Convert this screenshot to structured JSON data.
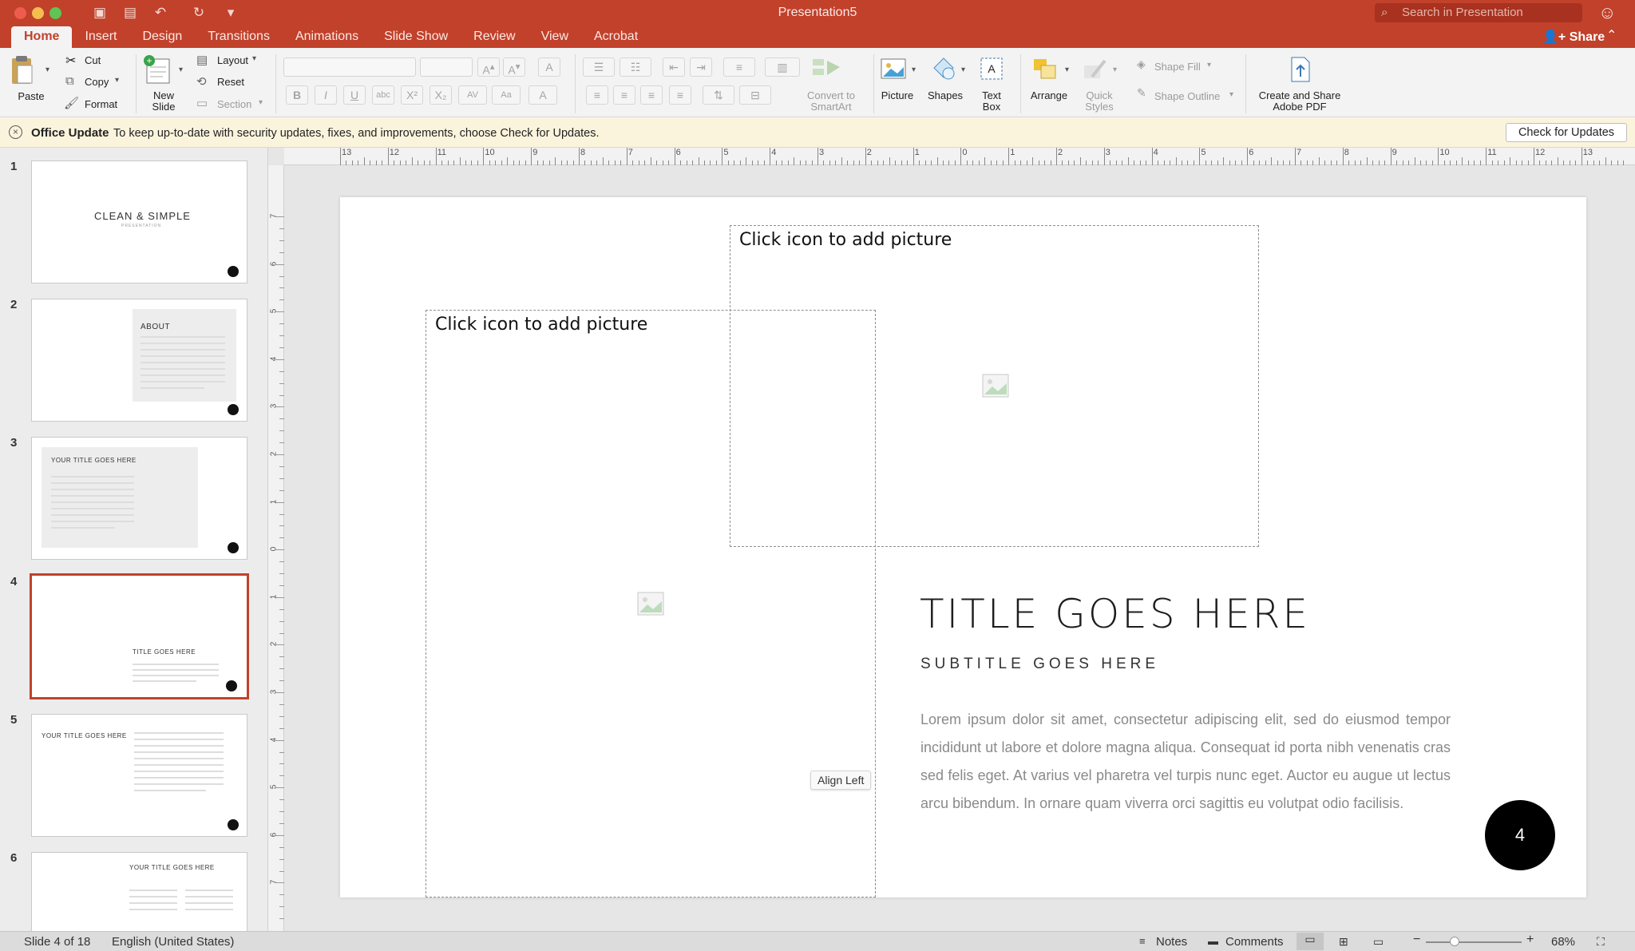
{
  "window": {
    "title": "Presentation5",
    "search_placeholder": "Search in Presentation"
  },
  "tabs": [
    "Home",
    "Insert",
    "Design",
    "Transitions",
    "Animations",
    "Slide Show",
    "Review",
    "View",
    "Acrobat"
  ],
  "share_label": "Share",
  "ribbon": {
    "paste": "Paste",
    "cut": "Cut",
    "copy": "Copy",
    "format": "Format",
    "new_slide_1": "New",
    "new_slide_2": "Slide",
    "layout": "Layout",
    "reset": "Reset",
    "section": "Section",
    "convert_smartart_1": "Convert to",
    "convert_smartart_2": "SmartArt",
    "picture": "Picture",
    "shapes": "Shapes",
    "text_box_1": "Text",
    "text_box_2": "Box",
    "arrange": "Arrange",
    "quick_styles_1": "Quick",
    "quick_styles_2": "Styles",
    "shape_fill": "Shape Fill",
    "shape_outline": "Shape Outline",
    "adobe_1": "Create and Share",
    "adobe_2": "Adobe PDF"
  },
  "update_bar": {
    "title": "Office Update",
    "message": "To keep up-to-date with security updates, fixes, and improvements, choose Check for Updates.",
    "button": "Check for Updates"
  },
  "thumbnails": {
    "numbers": [
      "1",
      "2",
      "3",
      "4",
      "5",
      "6"
    ],
    "t1_title": "CLEAN & SIMPLE",
    "t1_sub": "PRESENTATION",
    "t2_title": "ABOUT",
    "t3_title": "YOUR TITLE GOES HERE",
    "t4_title": "TITLE GOES HERE",
    "t5_title": "YOUR TITLE GOES HERE",
    "t6_title": "YOUR TITLE GOES HERE"
  },
  "ruler": {
    "h_labels": [
      "13",
      "12",
      "11",
      "10",
      "9",
      "8",
      "7",
      "6",
      "5",
      "4",
      "3",
      "2",
      "1",
      "0",
      "1",
      "2",
      "3",
      "4",
      "5",
      "6",
      "7",
      "8",
      "9",
      "10",
      "11",
      "12",
      "13"
    ],
    "v_labels": [
      "7",
      "6",
      "5",
      "4",
      "3",
      "2",
      "1",
      "0",
      "1",
      "2",
      "3",
      "4",
      "5",
      "6",
      "7"
    ]
  },
  "slide": {
    "placeholder_top": "Click icon to add picture",
    "placeholder_left": "Click icon to add picture",
    "title": "TITLE GOES HERE",
    "subtitle": "SUBTITLE GOES HERE",
    "body": "Lorem ipsum dolor sit amet, consectetur adipiscing elit, sed do eiusmod tempor incididunt ut labore et dolore magna aliqua. Consequat id porta nibh venenatis cras sed felis eget. At varius vel pharetra vel turpis nunc eget. Auctor eu augue ut lectus arcu bibendum. In ornare quam viverra orci sagittis eu volutpat odio facilisis.",
    "tooltip": "Align Left",
    "slide_number": "4"
  },
  "status": {
    "slide_indicator": "Slide 4 of 18",
    "language": "English (United States)",
    "notes": "Notes",
    "comments": "Comments",
    "zoom": "68%"
  },
  "colors": {
    "accent": "#c1412b",
    "update_bar": "#fbf4dd"
  }
}
